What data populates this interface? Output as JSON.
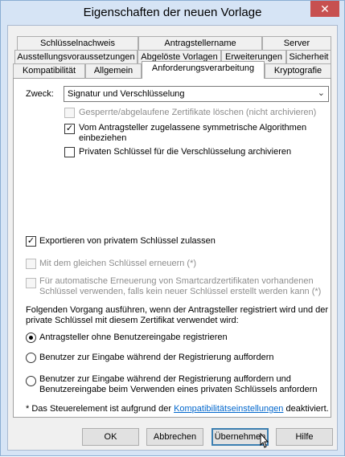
{
  "window": {
    "title": "Eigenschaften der neuen Vorlage",
    "close_symbol": "✕"
  },
  "tabs": {
    "row1": [
      "Schlüsselnachweis",
      "Antragstellername",
      "Server"
    ],
    "row2": [
      "Ausstellungsvoraussetzungen",
      "Abgelöste Vorlagen",
      "Erweiterungen",
      "Sicherheit"
    ],
    "row3": [
      "Kompatibilität",
      "Allgemein",
      "Anforderungsverarbeitung",
      "Kryptografie"
    ],
    "active": "Anforderungsverarbeitung"
  },
  "purpose": {
    "label": "Zweck:",
    "value": "Signatur und Verschlüsselung",
    "arrow": "⌄"
  },
  "options": {
    "delete_revoked": {
      "label": "Gesperrte/abgelaufene Zertifikate löschen (nicht archivieren)",
      "checked": false,
      "enabled": false
    },
    "symmetric_line1": "Vom Antragsteller zugelassene symmetrische Algorithmen",
    "symmetric_line2": "einbeziehen",
    "symmetric_checked": true,
    "archive_private_key": {
      "label": "Privaten Schlüssel für die Verschlüsselung archivieren",
      "checked": false
    }
  },
  "export": {
    "label": "Exportieren von privatem Schlüssel zulassen",
    "checked": true,
    "check_mark": "✓"
  },
  "renew_same_key": {
    "label": "Mit dem gleichen Schlüssel erneuern (*)",
    "checked": false,
    "enabled": false
  },
  "smartcard": {
    "line1": "Für automatische Erneuerung von Smartcardzertifikaten vorhandenen",
    "line2": "Schlüssel verwenden, falls kein neuer Schlüssel erstellt werden kann (*)",
    "checked": false,
    "enabled": false
  },
  "procedure": {
    "intro_line1": "Folgenden Vorgang ausführen, wenn der Antragsteller registriert wird und der",
    "intro_line2": "private Schlüssel mit diesem Zertifikat verwendet wird:",
    "radio1": "Antragsteller ohne Benutzereingabe registrieren",
    "radio2": "Benutzer zur Eingabe während der Registrierung auffordern",
    "radio3_line1": "Benutzer zur Eingabe während der Registrierung auffordern und",
    "radio3_line2": "Benutzereingabe beim Verwenden eines privaten Schlüssels anfordern",
    "selected": 1
  },
  "footnote": {
    "prefix": "* Das Steuerelement ist aufgrund der",
    "link": "Kompatibilitätseinstellungen",
    "suffix": "deaktiviert."
  },
  "buttons": {
    "ok": "OK",
    "cancel": "Abbrechen",
    "apply": "Übernehmen",
    "help": "Hilfe"
  }
}
